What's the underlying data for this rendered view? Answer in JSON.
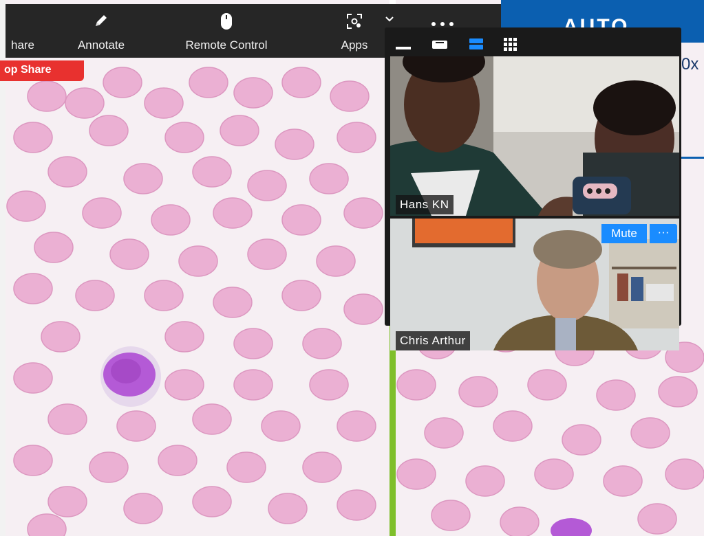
{
  "toolbar": {
    "items": [
      {
        "label": "hare",
        "icon": "share-screen-icon"
      },
      {
        "label": "Annotate",
        "icon": "pencil-icon"
      },
      {
        "label": "Remote Control",
        "icon": "mouse-icon"
      },
      {
        "label": "Apps",
        "icon": "apps-icon"
      }
    ],
    "more_icon": "more-options-icon",
    "chevron_icon": "chevron-down-icon"
  },
  "stop_share": {
    "label": "op Share"
  },
  "slide": {
    "header_text": "AUTO",
    "side_text": "0x"
  },
  "gallery": {
    "view_controls": [
      "minimize-icon",
      "speaker-view-icon",
      "active-speaker-strip-icon",
      "gallery-grid-icon"
    ],
    "participants": [
      {
        "name": "Hans KN"
      },
      {
        "name": "Chris Arthur",
        "mute_label": "Mute",
        "more_label": "···"
      }
    ]
  },
  "colors": {
    "toolbar_bg": "#262626",
    "stop_share": "#e8312f",
    "accent_blue": "#1a8cff",
    "slide_header_blue": "#0b5fb0",
    "rbc_fill": "#e9a8cf",
    "lymphocyte": "#b45ad6",
    "divider_green": "#7fbf2b"
  }
}
